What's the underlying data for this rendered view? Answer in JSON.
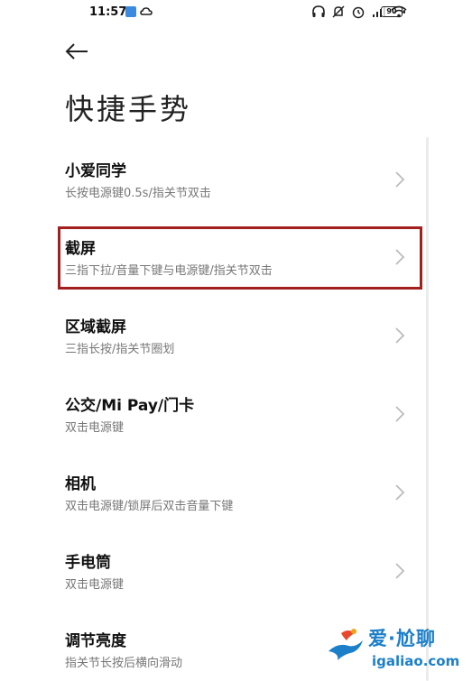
{
  "status": {
    "time": "11:57",
    "battery": "90"
  },
  "page": {
    "title": "快捷手势"
  },
  "items": [
    {
      "name": "小爱同学",
      "desc": "长按电源键0.5s/指关节双击"
    },
    {
      "name": "截屏",
      "desc": "三指下拉/音量下键与电源键/指关节双击"
    },
    {
      "name": "区域截屏",
      "desc": "三指长按/指关节圈划"
    },
    {
      "name": "公交/Mi Pay/门卡",
      "desc": "双击电源键"
    },
    {
      "name": "相机",
      "desc": "双击电源键/锁屏后双击音量下键"
    },
    {
      "name": "手电筒",
      "desc": "双击电源键"
    },
    {
      "name": "调节亮度",
      "desc": "指关节长按后横向滑动"
    }
  ],
  "watermark": {
    "line1": "爱·尬聊",
    "line2": "igaliao.com"
  },
  "colors": {
    "highlight": "#a41e1e",
    "watermark": "#1b7fc9"
  }
}
